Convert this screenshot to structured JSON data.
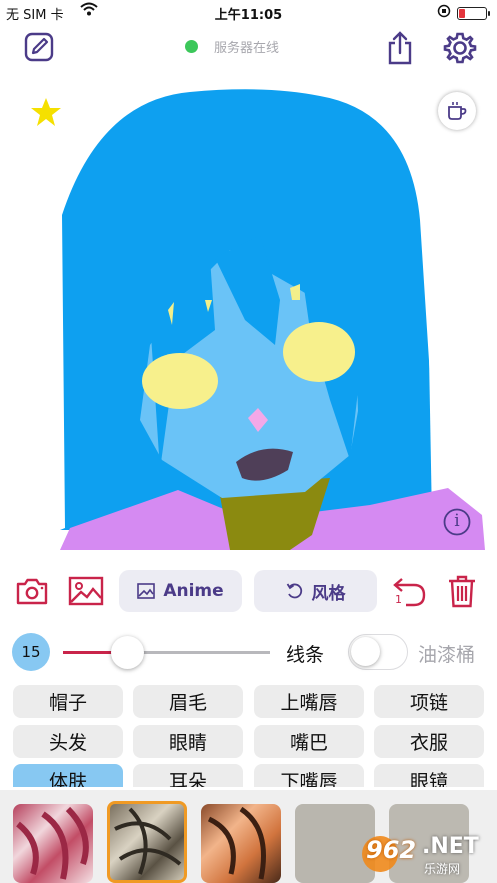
{
  "status_bar": {
    "carrier": "无 SIM 卡",
    "time": "上午11:05"
  },
  "top_bar": {
    "server_status": "服务器在线",
    "server_status_color": "#3cc75a"
  },
  "canvas": {
    "info_glyph": "i"
  },
  "toolbar": {
    "anime_label": "Anime",
    "style_label": "风格",
    "undo_count": "1",
    "accent_color": "#c9244a"
  },
  "brush": {
    "size": "15",
    "line_label": "线条",
    "bucket_label": "油漆桶",
    "bucket_on": false
  },
  "parts": [
    {
      "label": "帽子"
    },
    {
      "label": "眉毛"
    },
    {
      "label": "上嘴唇"
    },
    {
      "label": "项链"
    },
    {
      "label": "头发"
    },
    {
      "label": "眼睛"
    },
    {
      "label": "嘴巴"
    },
    {
      "label": "衣服"
    },
    {
      "label": "体肤",
      "selected": true
    },
    {
      "label": "耳朵"
    },
    {
      "label": "下嘴唇"
    },
    {
      "label": "眼镜"
    }
  ],
  "watermark": {
    "brand": "962",
    "suffix": ".NET",
    "sub": "乐游网"
  }
}
